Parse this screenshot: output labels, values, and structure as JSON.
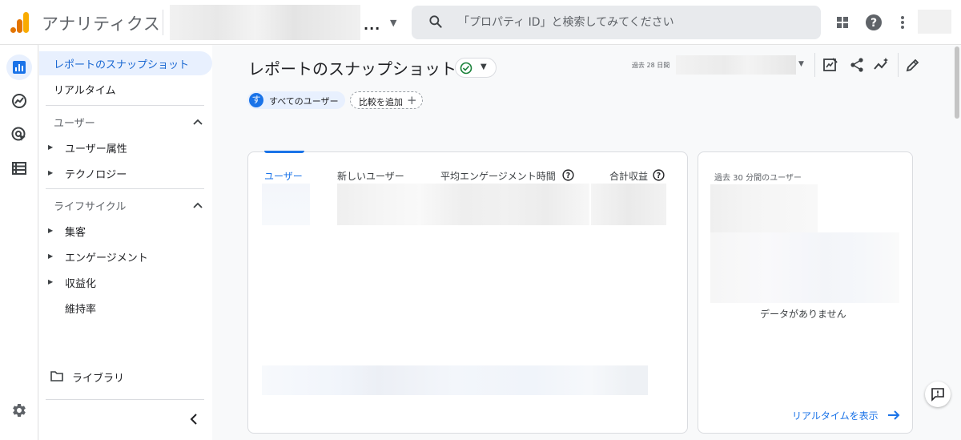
{
  "header": {
    "app_title": "アナリティクス",
    "account_ellipsis": "...",
    "search_placeholder": "「プロパティ ID」と検索してみてください"
  },
  "sidebar": {
    "snapshot": "レポートのスナップショット",
    "realtime": "リアルタイム",
    "user_section": "ユーザー",
    "user_items": [
      "ユーザー属性",
      "テクノロジー"
    ],
    "lifecycle_section": "ライフサイクル",
    "lifecycle_items": [
      "集客",
      "エンゲージメント",
      "収益化",
      "維持率"
    ],
    "library": "ライブラリ"
  },
  "main": {
    "page_title": "レポートのスナップショット",
    "date_range_label": "過去 28 日間",
    "segment_badge": "す",
    "segment_label": "すべてのユーザー",
    "compare_label": "比較を追加",
    "compare_plus": "+",
    "metric_tabs": [
      "ユーザー",
      "新しいユーザー",
      "平均エンゲージメント時間",
      "合計収益"
    ]
  },
  "realtime_card": {
    "title": "過去 30 分間のユーザー",
    "no_data": "データがありません",
    "link": "リアルタイムを表示"
  },
  "colors": {
    "accent": "#1a73e8",
    "active_bg": "#e8f0fe",
    "logo": [
      "#f9ab00",
      "#e37400"
    ]
  },
  "icons": [
    "analytics-logo",
    "search-icon",
    "apps-grid-icon",
    "help-icon",
    "more-vert-icon",
    "bar-chart-icon",
    "explore-icon",
    "advertising-icon",
    "table-icon",
    "settings-icon",
    "folder-icon",
    "chevron-left-icon",
    "check-circle-icon",
    "customize-icon",
    "share-icon",
    "insights-icon",
    "edit-icon",
    "arrow-forward-icon",
    "feedback-icon"
  ]
}
